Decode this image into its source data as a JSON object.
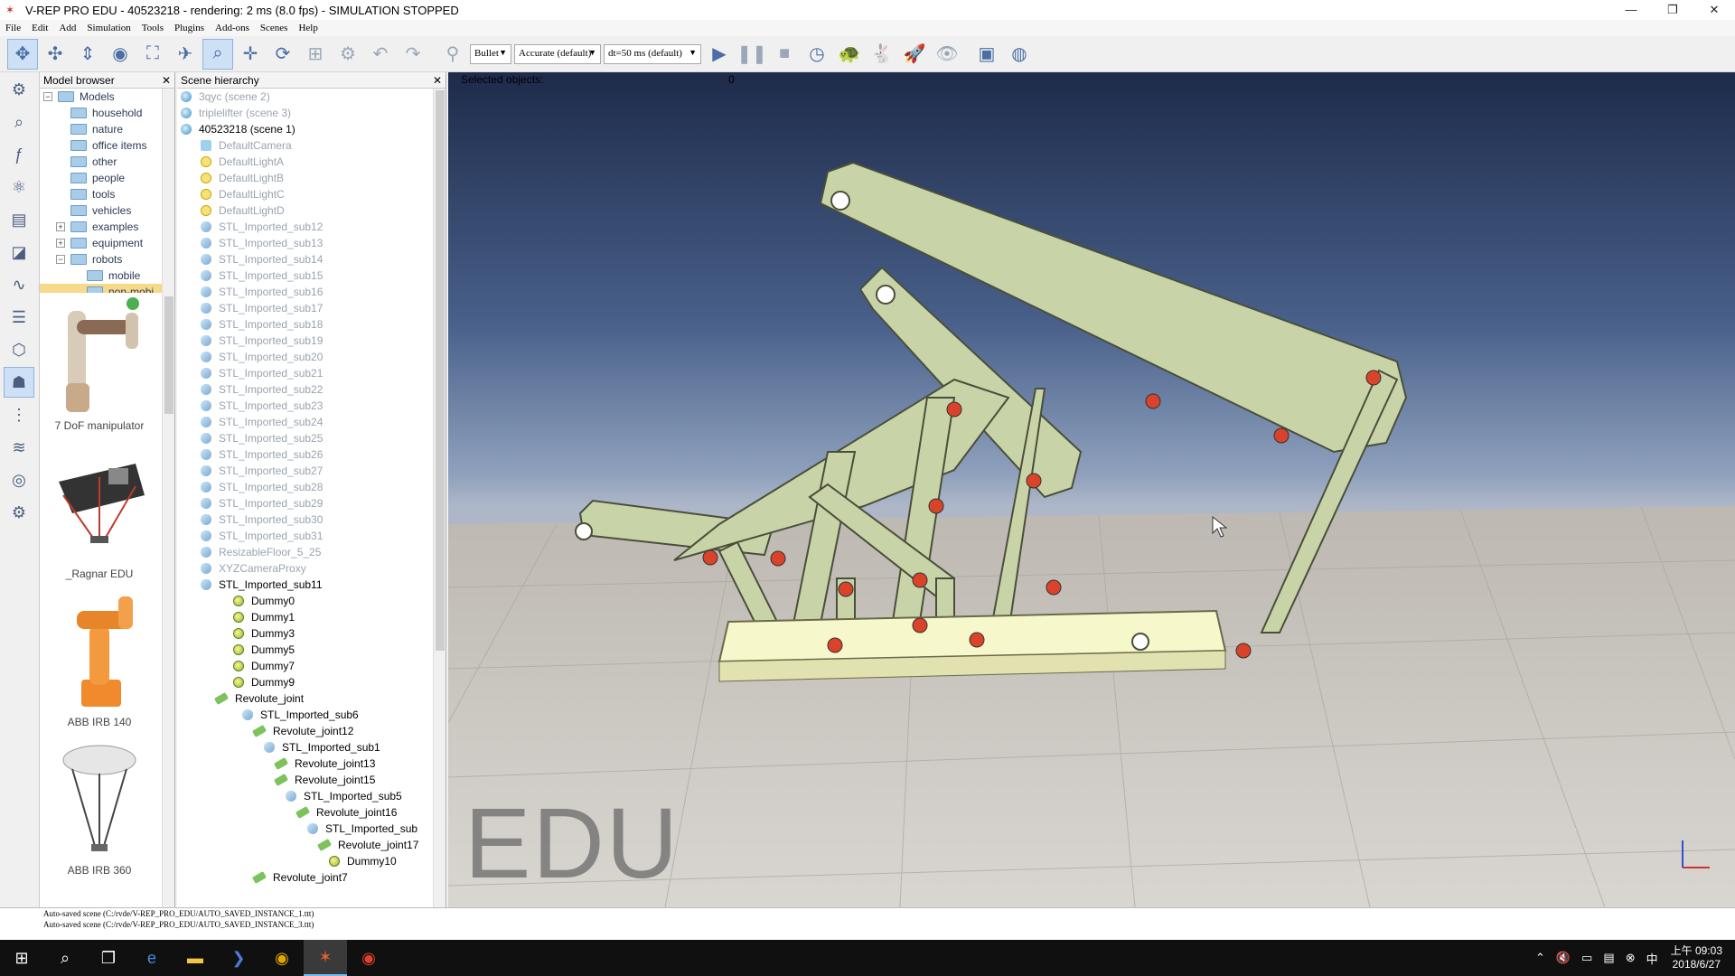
{
  "window": {
    "title": "V-REP PRO EDU - 40523218 - rendering: 2 ms (8.0 fps) - SIMULATION STOPPED",
    "minimize": "—",
    "maximize": "❐",
    "close": "✕"
  },
  "menu": [
    "File",
    "Edit",
    "Add",
    "Simulation",
    "Tools",
    "Plugins",
    "Add-ons",
    "Scenes",
    "Help"
  ],
  "toolbar": {
    "engine": "Bullet",
    "accuracy": "Accurate (default)",
    "timestep": "dt=50 ms (default)"
  },
  "model_browser": {
    "title": "Model browser",
    "close": "✕",
    "root": "Models",
    "folders": [
      "household",
      "nature",
      "office items",
      "other",
      "people",
      "tools",
      "vehicles",
      "examples",
      "equipment",
      "robots",
      "mobile",
      "non-mobi..."
    ],
    "thumbnails": [
      "7 DoF manipulator",
      "_Ragnar EDU",
      "ABB IRB 140",
      "ABB IRB 360"
    ]
  },
  "scene_hierarchy": {
    "title": "Scene hierarchy",
    "close": "✕",
    "scenes": [
      "3qyc (scene 2)",
      "triplelifter (scene 3)",
      "40523218 (scene 1)"
    ],
    "objects": [
      "DefaultCamera",
      "DefaultLightA",
      "DefaultLightB",
      "DefaultLightC",
      "DefaultLightD",
      "STL_Imported_sub12",
      "STL_Imported_sub13",
      "STL_Imported_sub14",
      "STL_Imported_sub15",
      "STL_Imported_sub16",
      "STL_Imported_sub17",
      "STL_Imported_sub18",
      "STL_Imported_sub19",
      "STL_Imported_sub20",
      "STL_Imported_sub21",
      "STL_Imported_sub22",
      "STL_Imported_sub23",
      "STL_Imported_sub24",
      "STL_Imported_sub25",
      "STL_Imported_sub26",
      "STL_Imported_sub27",
      "STL_Imported_sub28",
      "STL_Imported_sub29",
      "STL_Imported_sub30",
      "STL_Imported_sub31",
      "ResizableFloor_5_25",
      "XYZCameraProxy",
      "STL_Imported_sub11",
      "Dummy0",
      "Dummy1",
      "Dummy3",
      "Dummy5",
      "Dummy7",
      "Dummy9",
      "Revolute_joint",
      "STL_Imported_sub6",
      "Revolute_joint12",
      "STL_Imported_sub1",
      "Revolute_joint13",
      "Revolute_joint15",
      "STL_Imported_sub5",
      "Revolute_joint16",
      "STL_Imported_sub",
      "Revolute_joint17",
      "Dummy10",
      "Revolute_joint7"
    ]
  },
  "viewport": {
    "selected_label": "Selected objects:",
    "selected_count": "0",
    "watermark": "EDU"
  },
  "status": {
    "line1": "Auto-saved scene (C:/rvde/V-REP_PRO_EDU/AUTO_SAVED_INSTANCE_1.ttt)",
    "line2": "Auto-saved scene (C:/rvde/V-REP_PRO_EDU/AUTO_SAVED_INSTANCE_3.ttt)"
  },
  "taskbar": {
    "time": "上午 09:03",
    "date": "2018/6/27"
  },
  "colors": {
    "mechanism": "#c9d3a8",
    "base": "#f7f7cc",
    "joint": "#d9432a"
  }
}
